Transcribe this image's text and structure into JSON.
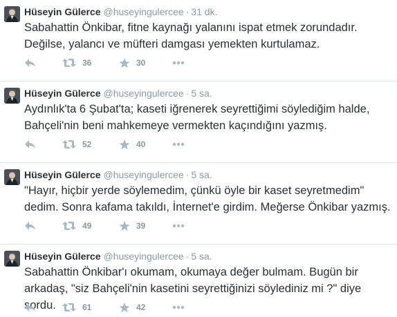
{
  "tweets": [
    {
      "fullname": "Hüseyin Gülerce",
      "username": "@huseyingulercee",
      "separator": "·",
      "time": "31 dk.",
      "text": "Sabahattin Önkibar, fitne kaynağı yalanını ispat etmek zorundadır.\nDeğilse, yalancı ve müfteri damgası yemekten kurtulamaz.",
      "retweets": "36",
      "favorites": "30"
    },
    {
      "fullname": "Hüseyin Gülerce",
      "username": "@huseyingulercee",
      "separator": "·",
      "time": "5 sa.",
      "text": "Aydınlık'ta 6 Şubat'ta; kaseti iğrenerek seyrettiğimi söylediğim halde,\nBahçeli'nin beni mahkemeye vermekten kaçındığını yazmış.",
      "retweets": "52",
      "favorites": "40"
    },
    {
      "fullname": "Hüseyin Gülerce",
      "username": "@huseyingulercee",
      "separator": "·",
      "time": "5 sa.",
      "text": "\"Hayır, hiçbir yerde söylemedim, çünkü öyle bir kaset seyretmedim\"\ndedim. Sonra kafama takıldı, İnternet'e girdim. Meğerse Önkibar yazmış.",
      "retweets": "49",
      "favorites": "39"
    },
    {
      "fullname": "Hüseyin Gülerce",
      "username": "@huseyingulercee",
      "separator": "·",
      "time": "5 sa.",
      "text": "Sabahattin Önkibar'ı okumam, okumaya değer bulmam. Bugün bir\narkadaş, \"siz Bahçeli'nin kasetini seyrettiğinizi söylediniz mi ?\" diye sordu.",
      "retweets": "61",
      "favorites": "42"
    }
  ],
  "icons": {
    "reply": "reply-icon",
    "retweet": "retweet-icon",
    "favorite": "star-icon",
    "more": "more-dots-icon"
  },
  "colors": {
    "text": "#292f33",
    "muted": "#8899a6",
    "icon": "#aab8c2",
    "divider": "#e1e8ed"
  }
}
